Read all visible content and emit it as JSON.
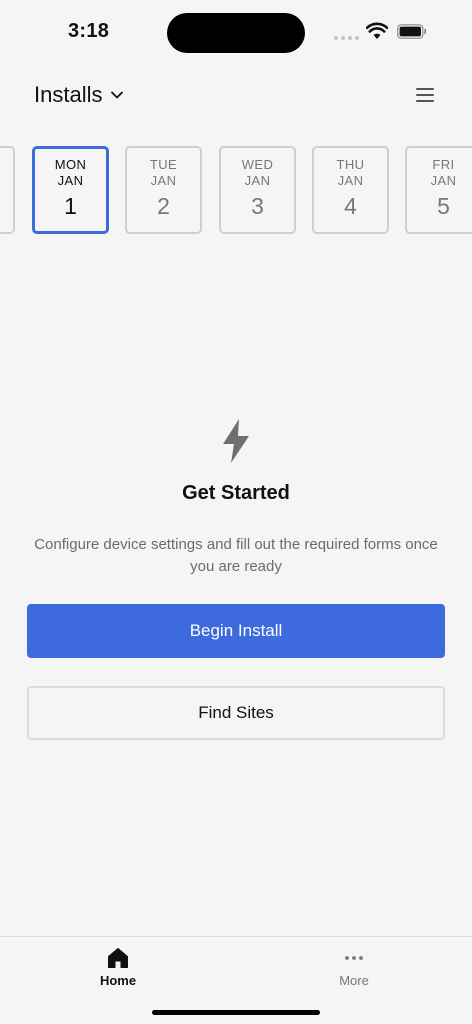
{
  "status_bar": {
    "time": "3:18"
  },
  "header": {
    "title": "Installs"
  },
  "days": [
    {
      "weekday": "",
      "month": "",
      "day": ""
    },
    {
      "weekday": "MON",
      "month": "JAN",
      "day": "1"
    },
    {
      "weekday": "TUE",
      "month": "JAN",
      "day": "2"
    },
    {
      "weekday": "WED",
      "month": "JAN",
      "day": "3"
    },
    {
      "weekday": "THU",
      "month": "JAN",
      "day": "4"
    },
    {
      "weekday": "FRI",
      "month": "JAN",
      "day": "5"
    }
  ],
  "empty_state": {
    "title": "Get Started",
    "description": "Configure device settings and fill out the required forms once you are ready"
  },
  "actions": {
    "primary_label": "Begin Install",
    "secondary_label": "Find Sites"
  },
  "bottom_nav": {
    "home_label": "Home",
    "more_label": "More"
  },
  "colors": {
    "accent": "#3d6bdd",
    "background": "#f5f5f5"
  }
}
